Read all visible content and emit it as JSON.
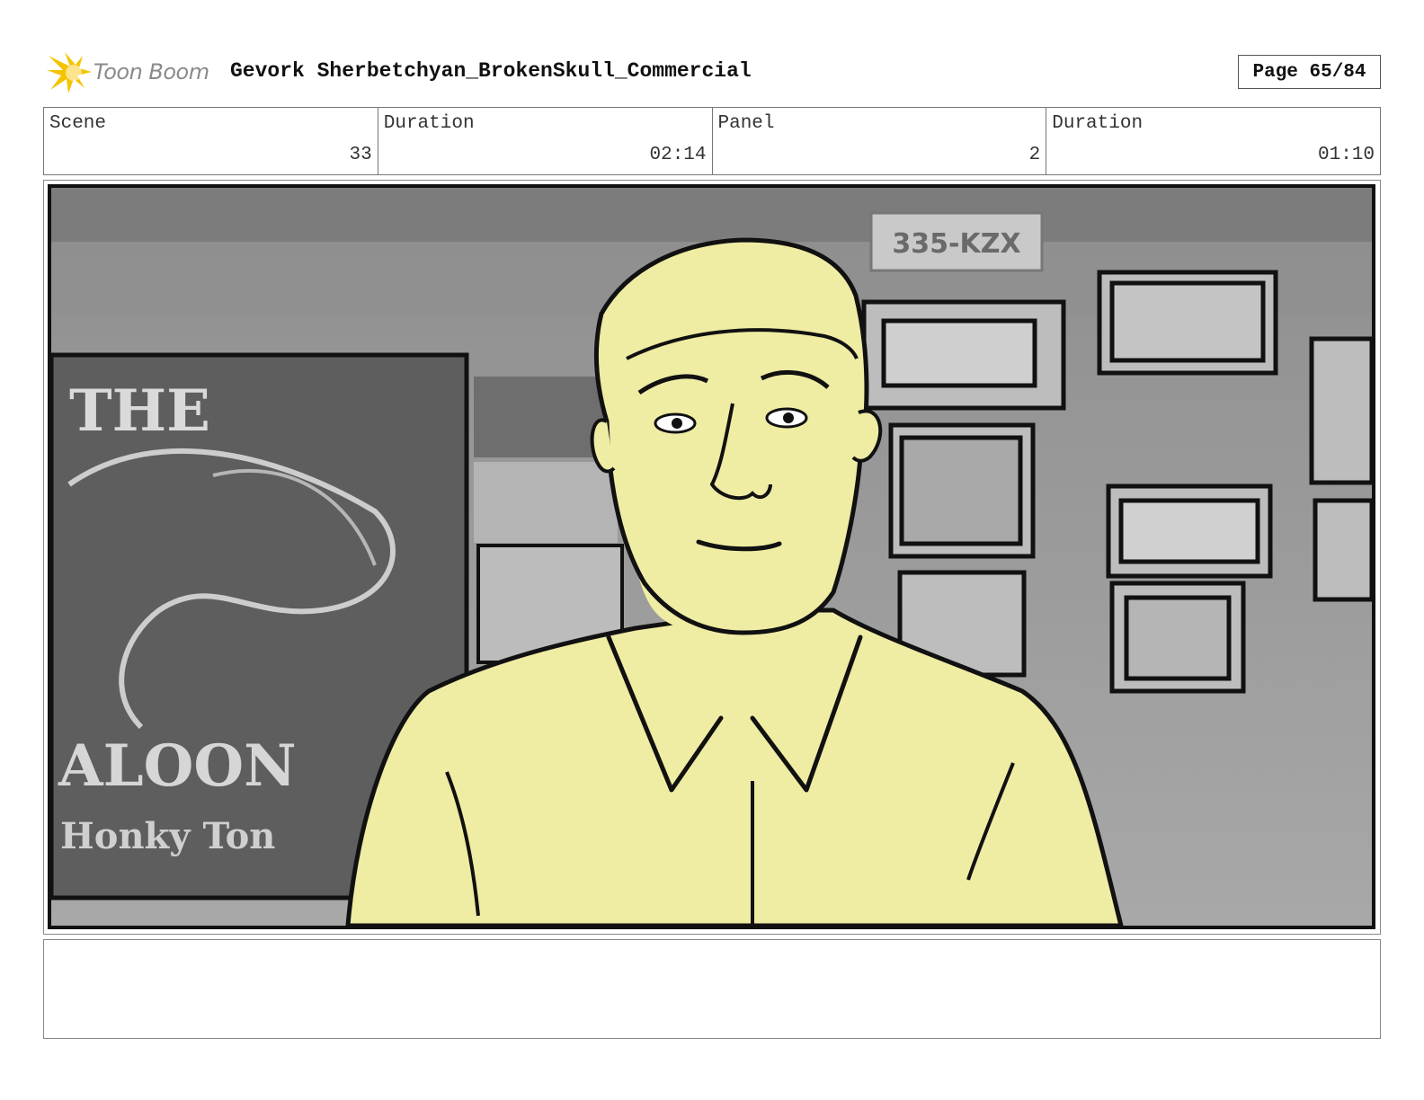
{
  "header": {
    "logo_text": "Toon Boom",
    "project_title": "Gevork Sherbetchyan_BrokenSkull_Commercial",
    "page_label": "Page 65/84"
  },
  "info": {
    "scene_label": "Scene",
    "scene_value": "33",
    "scene_duration_label": "Duration",
    "scene_duration_value": "02:14",
    "panel_label": "Panel",
    "panel_value": "2",
    "panel_duration_label": "Duration",
    "panel_duration_value": "01:10"
  },
  "panel": {
    "background_texts": {
      "plate": "335-KZX",
      "sign_top": "THE",
      "sign_mid": "ALOON",
      "sign_bottom": "Honky Ton"
    },
    "character_fill_color": "#efeca4"
  },
  "caption": {
    "text": ""
  },
  "colors": {
    "logo_yellow": "#f5c400",
    "outline": "#111111"
  }
}
